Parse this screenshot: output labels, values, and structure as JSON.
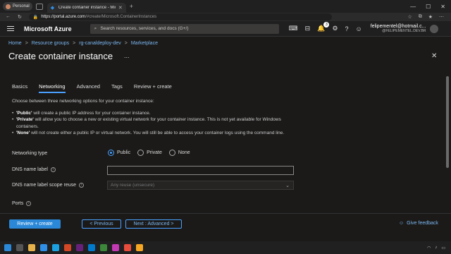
{
  "browser": {
    "profile_label": "Personal",
    "tab_title": "Create container instance - Micr",
    "url_host": "https://portal.azure.com",
    "url_path": "/#create/Microsoft.ContainerInstances"
  },
  "azure": {
    "brand": "Microsoft Azure",
    "search_placeholder": "Search resources, services, and docs (G+/)",
    "notification_count": "3",
    "user_name": "felipementel@hotmail.c...",
    "user_directory": "@FELIPEMENTEL.DEV.BR"
  },
  "breadcrumb": [
    "Home",
    "Resource groups",
    "rg-canaldeploy-dev",
    "Marketplace"
  ],
  "page": {
    "title": "Create container instance",
    "ellipsis": "...",
    "close": "✕"
  },
  "tabs": [
    {
      "label": "Basics",
      "active": false
    },
    {
      "label": "Networking",
      "active": true
    },
    {
      "label": "Advanced",
      "active": false
    },
    {
      "label": "Tags",
      "active": false
    },
    {
      "label": "Review + create",
      "active": false
    }
  ],
  "networking": {
    "intro": "Choose between three networking options for your container instance:",
    "bullets": [
      {
        "term": "'Public'",
        "text": " will create a public IP address for your container instance."
      },
      {
        "term": "'Private'",
        "text": " will allow you to choose a new or existing virtual network for your container instance. This is not yet available for Windows containers."
      },
      {
        "term": "'None'",
        "text": " will not create either a public IP or virtual network. You will still be able to access your container logs using the command line."
      }
    ],
    "networking_type_label": "Networking type",
    "options": [
      "Public",
      "Private",
      "None"
    ],
    "selected_option": "Public",
    "dns_label": "DNS name label",
    "dns_value": "",
    "dns_scope_label": "DNS name label scope reuse",
    "dns_scope_placeholder": "Any reuse (unsecure)",
    "ports_label": "Ports"
  },
  "footer": {
    "review_create": "Review + create",
    "previous": "< Previous",
    "next": "Next : Advanced >",
    "feedback": "Give feedback"
  },
  "colors": {
    "accent": "#2b88d8",
    "link": "#7bb7f0",
    "background": "#1b1a19"
  }
}
